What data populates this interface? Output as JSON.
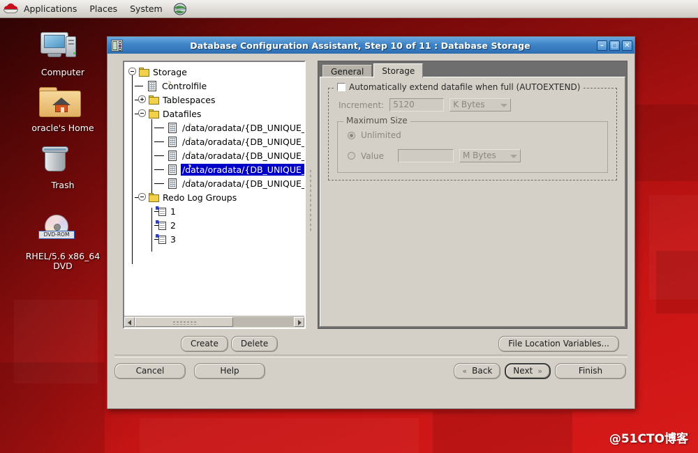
{
  "panel": {
    "logo": "redhat-logo",
    "menus": [
      "Applications",
      "Places",
      "System"
    ],
    "tray_icon": "globe-icon"
  },
  "desktop": {
    "icons": [
      {
        "label": "Computer",
        "icon": "computer-icon"
      },
      {
        "label": "oracle's Home",
        "icon": "home-folder-icon"
      },
      {
        "label": "Trash",
        "icon": "trash-icon"
      },
      {
        "label": "RHEL/5.6 x86_64 DVD",
        "icon": "dvd-disc-icon",
        "badge": "DVD-ROM"
      }
    ]
  },
  "window": {
    "title": "Database Configuration Assistant, Step 10 of 11 : Database Storage",
    "icon": "database-icon",
    "controls": {
      "minimize": "–",
      "maximize": "□",
      "close": "✕"
    }
  },
  "tree": {
    "root": "Storage",
    "nodes": [
      "Controlfile",
      "Tablespaces",
      "Datafiles",
      "Redo Log Groups"
    ],
    "datafiles": [
      "/data/oradata/{DB_UNIQUE_NAM",
      "/data/oradata/{DB_UNIQUE_NAM",
      "/data/oradata/{DB_UNIQUE_NAM",
      "/data/oradata/{DB_UNIQUE_NAM",
      "/data/oradata/{DB_UNIQUE_NAM"
    ],
    "selected_index": 3,
    "redo_groups": [
      "1",
      "2",
      "3"
    ]
  },
  "tabs": [
    {
      "label": "General",
      "active": false
    },
    {
      "label": "Storage",
      "active": true
    }
  ],
  "storage_tab": {
    "autoextend": {
      "label": "Automatically extend datafile when full (AUTOEXTEND)",
      "checked": false
    },
    "increment": {
      "label": "Increment:",
      "value": "5120",
      "unit": "K Bytes"
    },
    "maximum_size": {
      "legend": "Maximum Size",
      "unlimited_label": "Unlimited",
      "unlimited_selected": true,
      "value_label": "Value",
      "value": "",
      "unit": "M Bytes"
    }
  },
  "actions": {
    "create": "Create",
    "delete": "Delete",
    "file_location_variables": "File Location Variables..."
  },
  "navigation": {
    "cancel": "Cancel",
    "help": "Help",
    "back": "Back",
    "next": "Next",
    "finish": "Finish",
    "back_chevron": "«",
    "next_chevron": "»"
  },
  "watermark": "@51CTO博客",
  "colors": {
    "titlebar": "#3e84c6",
    "selection": "#0000c8",
    "window_face": "#d4d0c8",
    "desktop": "#a51010"
  }
}
